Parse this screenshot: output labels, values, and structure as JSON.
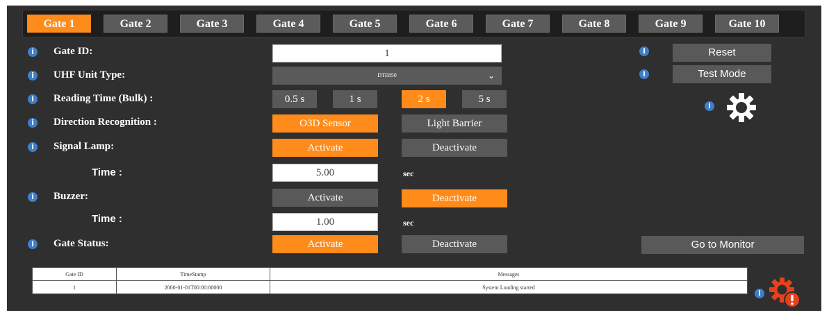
{
  "tabs": [
    "Gate 1",
    "Gate 2",
    "Gate 3",
    "Gate 4",
    "Gate 5",
    "Gate 6",
    "Gate 7",
    "Gate 8",
    "Gate 9",
    "Gate 10"
  ],
  "active_tab": "Gate 1",
  "form": {
    "gate_id": {
      "label": "Gate ID:",
      "value": "1"
    },
    "uhf_unit_type": {
      "label": "UHF Unit Type:",
      "value": "DTE850"
    },
    "reading_time": {
      "label": "Reading Time (Bulk) :",
      "options": [
        "0.5 s",
        "1 s",
        "2 s",
        "5 s"
      ],
      "selected": "2 s"
    },
    "direction_recognition": {
      "label": "Direction Recognition :",
      "options": [
        "O3D Sensor",
        "Light Barrier"
      ],
      "selected": "O3D Sensor"
    },
    "signal_lamp": {
      "label": "Signal Lamp:",
      "activate": "Activate",
      "deactivate": "Deactivate",
      "selected": "Activate"
    },
    "signal_lamp_time": {
      "label": "Time :",
      "value": "5.00",
      "unit": "sec"
    },
    "buzzer": {
      "label": "Buzzer:",
      "activate": "Activate",
      "deactivate": "Deactivate",
      "selected": "Deactivate"
    },
    "buzzer_time": {
      "label": "Time :",
      "value": "1.00",
      "unit": "sec"
    },
    "gate_status": {
      "label": "Gate Status:",
      "activate": "Activate",
      "deactivate": "Deactivate",
      "selected": "Activate"
    }
  },
  "side_buttons": {
    "reset": "Reset",
    "test_mode": "Test Mode",
    "go_to_monitor": "Go to Monitor"
  },
  "info_glyph": "i",
  "log_table": {
    "columns": [
      "Gate ID",
      "TimeStamp",
      "Messages"
    ],
    "rows": [
      [
        "1",
        "2000-01-01T00:00:00000",
        "System Loading started"
      ]
    ]
  },
  "icons": {
    "settings": "gear-icon",
    "alert_settings": "gear-alert-icon",
    "info": "info-icon"
  },
  "colors": {
    "accent": "#ff8c1a",
    "panel": "#2f2f2f",
    "button": "#595959",
    "info": "#3d7fc9",
    "alert": "#e8401c"
  }
}
